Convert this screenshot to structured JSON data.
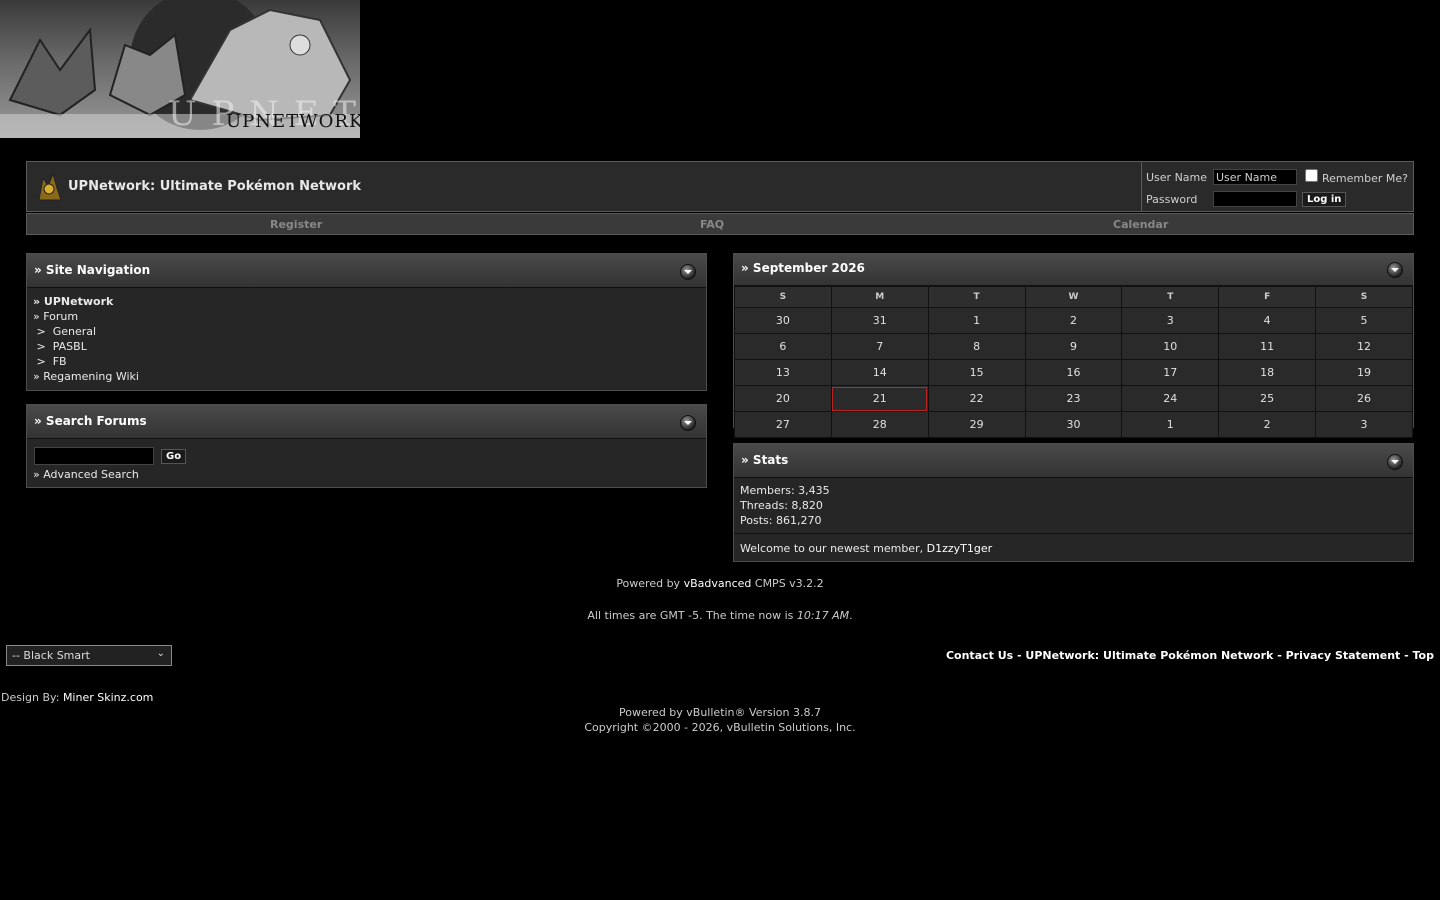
{
  "banner": {
    "wordmark": "UPNETWORK"
  },
  "header": {
    "title": "UPNetwork: Ultimate Pokémon Network",
    "username_label": "User Name",
    "username_value": "User Name",
    "password_label": "Password",
    "remember_label": "Remember Me?",
    "login_button": "Log in"
  },
  "navbar": {
    "items": [
      "Register",
      "FAQ",
      "Calendar"
    ]
  },
  "site_nav": {
    "title": "» Site Navigation",
    "items": [
      "» UPNetwork",
      "» Forum",
      " >  General",
      " >  PASBL",
      " >  FB",
      "» Regamening Wiki"
    ]
  },
  "search": {
    "title": "» Search Forums",
    "go_button": "Go",
    "advanced": "» Advanced Search"
  },
  "calendar": {
    "title": "» September 2026",
    "weekdays": [
      "S",
      "M",
      "T",
      "W",
      "T",
      "F",
      "S"
    ],
    "weeks": [
      [
        "30",
        "31",
        "1",
        "2",
        "3",
        "4",
        "5"
      ],
      [
        "6",
        "7",
        "8",
        "9",
        "10",
        "11",
        "12"
      ],
      [
        "13",
        "14",
        "15",
        "16",
        "17",
        "18",
        "19"
      ],
      [
        "20",
        "21",
        "22",
        "23",
        "24",
        "25",
        "26"
      ],
      [
        "27",
        "28",
        "29",
        "30",
        "1",
        "2",
        "3"
      ]
    ],
    "today": "21"
  },
  "stats": {
    "title": "» Stats",
    "members": "Members: 3,435",
    "threads": "Threads: 8,820",
    "posts": "Posts: 861,270",
    "welcome_prefix": "Welcome to our newest member, ",
    "newest_member": "D1zzyT1ger"
  },
  "footer": {
    "powered_prefix": "Powered by ",
    "powered_link": "vBadvanced",
    "powered_suffix": " CMPS v3.2.2",
    "times_prefix": "All times are GMT -5. The time now is ",
    "time_now": "10:17 AM",
    "times_suffix": ".",
    "style_select": "-- Black Smart",
    "links": "Contact Us - UPNetwork: Ultimate Pokémon Network - Privacy Statement - Top",
    "design_prefix": "Design By: ",
    "design_link": "Miner Skinz.com",
    "vb_line": "Powered by vBulletin® Version 3.8.7",
    "copyright": "Copyright ©2000 - 2026, vBulletin Solutions, Inc."
  }
}
